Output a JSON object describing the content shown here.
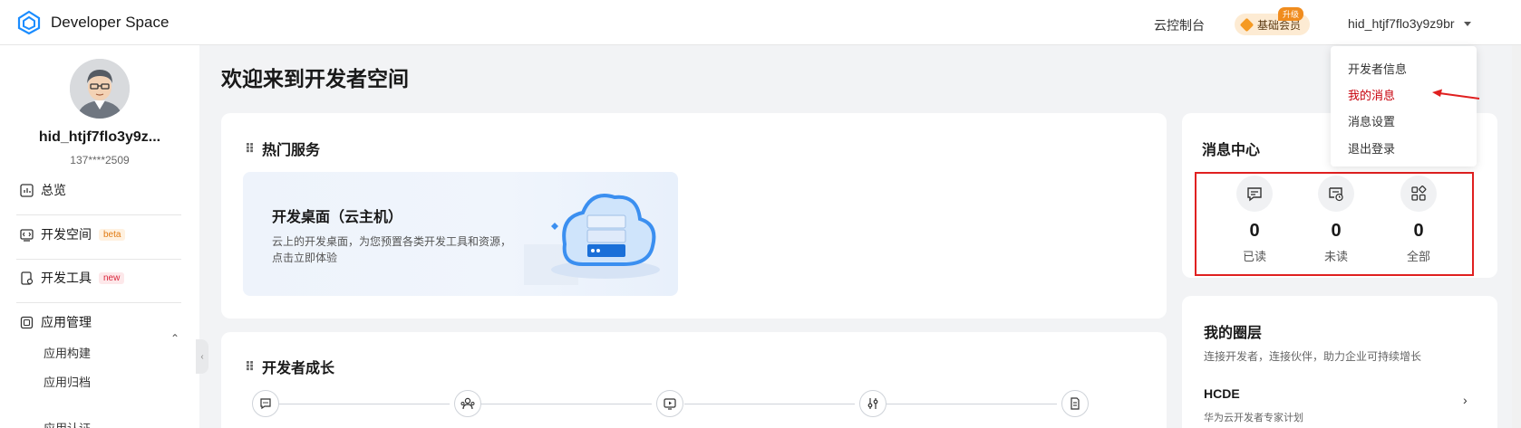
{
  "header": {
    "brand": "Developer Space",
    "console": "云控制台",
    "member_label": "基础会员",
    "upgrade_tag": "升级",
    "username": "hid_htjf7flo3y9z9br"
  },
  "dropdown": {
    "items": [
      {
        "label": "开发者信息",
        "active": false
      },
      {
        "label": "我的消息",
        "active": true
      },
      {
        "label": "消息设置",
        "active": false
      },
      {
        "label": "退出登录",
        "active": false
      }
    ]
  },
  "sidebar": {
    "name": "hid_htjf7flo3y9z...",
    "phone": "137****2509",
    "items": [
      {
        "label": "总览",
        "icon": "chart-icon"
      },
      {
        "label": "开发空间",
        "icon": "code-window-icon",
        "tag": "beta"
      },
      {
        "label": "开发工具",
        "icon": "device-icon",
        "tag": "new"
      },
      {
        "label": "应用管理",
        "icon": "app-icon"
      }
    ],
    "sub_items": [
      "应用构建",
      "应用归档",
      "应用认证"
    ]
  },
  "main": {
    "title": "欢迎来到开发者空间",
    "hot_services": {
      "title": "热门服务",
      "card_title": "开发桌面（云主机）",
      "card_desc": "云上的开发桌面，为您预置各类开发工具和资源，点击立即体验"
    },
    "growth": {
      "title": "开发者成长",
      "steps": [
        "chat-icon",
        "people-icon",
        "play-icon",
        "settings-sliders-icon",
        "document-icon"
      ]
    }
  },
  "message_center": {
    "title": "消息中心",
    "stats": [
      {
        "value": "0",
        "label": "已读",
        "icon": "message-icon"
      },
      {
        "value": "0",
        "label": "未读",
        "icon": "unread-message-icon"
      },
      {
        "value": "0",
        "label": "全部",
        "icon": "grid-icon"
      }
    ]
  },
  "circle": {
    "title": "我的圈层",
    "subtitle": "连接开发者，连接伙伴，助力企业可持续增长",
    "hcde_title": "HCDE",
    "hcde_subtitle": "华为云开发者专家计划"
  },
  "colors": {
    "accent_red": "#c7000b",
    "highlight_box": "#e02020",
    "member_orange": "#f08c1e"
  }
}
